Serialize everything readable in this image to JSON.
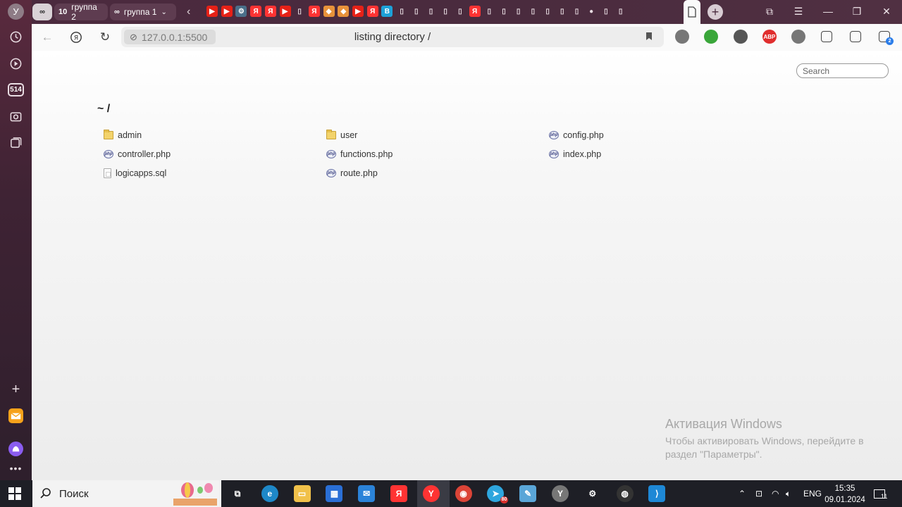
{
  "sidebar": {
    "avatar_letter": "У",
    "counter_badge": "514"
  },
  "tabs": {
    "groups": [
      {
        "label": "",
        "count": ""
      },
      {
        "label": "группа 2",
        "count": "10"
      },
      {
        "label": "группа 1",
        "count": "oo"
      }
    ],
    "pinned_icons": [
      {
        "icon": "youtube-icon",
        "color": "#e62117",
        "glyph": "▶"
      },
      {
        "icon": "youtube-icon",
        "color": "#e62117",
        "glyph": "▶"
      },
      {
        "icon": "settings-icon",
        "color": "#4a6f8a",
        "glyph": "⚙"
      },
      {
        "icon": "yandex-icon",
        "color": "#f33",
        "glyph": "Я"
      },
      {
        "icon": "yandex-icon",
        "color": "#f33",
        "glyph": "Я"
      },
      {
        "icon": "youtube-icon",
        "color": "#e62117",
        "glyph": "▶"
      },
      {
        "icon": "document-icon",
        "color": "transparent",
        "glyph": "▯"
      },
      {
        "icon": "yandex-icon",
        "color": "#f33",
        "glyph": "Я"
      },
      {
        "icon": "diamond-icon",
        "color": "#e8923a",
        "glyph": "◆"
      },
      {
        "icon": "diamond-icon",
        "color": "#e8923a",
        "glyph": "◆"
      },
      {
        "icon": "youtube-icon",
        "color": "#e62117",
        "glyph": "▶"
      },
      {
        "icon": "yandex-icon",
        "color": "#f33",
        "glyph": "Я"
      },
      {
        "icon": "bookmark-blue-icon",
        "color": "#1da1d8",
        "glyph": "B"
      },
      {
        "icon": "document-icon",
        "color": "transparent",
        "glyph": "▯"
      },
      {
        "icon": "document-icon",
        "color": "transparent",
        "glyph": "▯"
      },
      {
        "icon": "document-icon",
        "color": "transparent",
        "glyph": "▯"
      },
      {
        "icon": "document-icon",
        "color": "transparent",
        "glyph": "▯"
      },
      {
        "icon": "document-icon",
        "color": "transparent",
        "glyph": "▯"
      },
      {
        "icon": "yandex-icon",
        "color": "#f33",
        "glyph": "Я"
      },
      {
        "icon": "document-icon",
        "color": "transparent",
        "glyph": "▯"
      },
      {
        "icon": "document-icon",
        "color": "transparent",
        "glyph": "▯"
      },
      {
        "icon": "document-icon",
        "color": "transparent",
        "glyph": "▯"
      },
      {
        "icon": "document-icon",
        "color": "transparent",
        "glyph": "▯"
      },
      {
        "icon": "document-icon",
        "color": "transparent",
        "glyph": "▯"
      },
      {
        "icon": "document-icon",
        "color": "transparent",
        "glyph": "▯"
      },
      {
        "icon": "document-icon",
        "color": "transparent",
        "glyph": "▯"
      },
      {
        "icon": "github-icon",
        "color": "transparent",
        "glyph": "●"
      },
      {
        "icon": "document-icon",
        "color": "transparent",
        "glyph": "▯"
      },
      {
        "icon": "document-icon",
        "color": "transparent",
        "glyph": "▯"
      }
    ]
  },
  "address_bar": {
    "url": "127.0.0.1:5500",
    "page_title": "listing directory /"
  },
  "extensions": [
    {
      "icon": "circle-ext-icon",
      "color": "#777",
      "label": ""
    },
    {
      "icon": "download-arrow-ext-icon",
      "color": "#3aa63a",
      "label": ""
    },
    {
      "icon": "planet-ext-icon",
      "color": "#555",
      "label": ""
    },
    {
      "icon": "adblock-ext-icon",
      "color": "#e02d2d",
      "label": "ABP"
    },
    {
      "icon": "shield-ext-icon",
      "color": "#777",
      "label": ""
    },
    {
      "icon": "puzzle-ext-icon",
      "color": "transparent",
      "label": ""
    },
    {
      "icon": "screen-ext-icon",
      "color": "transparent",
      "label": ""
    },
    {
      "icon": "downloads-icon",
      "color": "transparent",
      "label": "2"
    }
  ],
  "listing": {
    "search_placeholder": "Search",
    "heading": "~ /",
    "entries": [
      {
        "name": "admin",
        "type": "folder"
      },
      {
        "name": "user",
        "type": "folder"
      },
      {
        "name": "config.php",
        "type": "php"
      },
      {
        "name": "controller.php",
        "type": "php"
      },
      {
        "name": "functions.php",
        "type": "php"
      },
      {
        "name": "index.php",
        "type": "php"
      },
      {
        "name": "logicapps.sql",
        "type": "sql"
      },
      {
        "name": "route.php",
        "type": "php"
      }
    ]
  },
  "watermark": {
    "title": "Активация Windows",
    "text": "Чтобы активировать Windows, перейдите в раздел \"Параметры\"."
  },
  "taskbar": {
    "search_label": "Поиск",
    "apps": [
      {
        "name": "task-view-icon",
        "color": "transparent",
        "glyph": "⧉"
      },
      {
        "name": "edge-icon",
        "color": "#1e88c8",
        "glyph": "e"
      },
      {
        "name": "explorer-icon",
        "color": "#f1c14a",
        "glyph": "▭"
      },
      {
        "name": "store-icon",
        "color": "#2a6fd6",
        "glyph": "▦"
      },
      {
        "name": "mail-icon",
        "color": "#2b83d9",
        "glyph": "✉"
      },
      {
        "name": "yandex-icon",
        "color": "#f33",
        "glyph": "Я"
      },
      {
        "name": "yandex-browser-icon",
        "color": "#f33",
        "glyph": "Y"
      },
      {
        "name": "chrome-icon",
        "color": "#db4437",
        "glyph": "◉"
      },
      {
        "name": "telegram-icon",
        "color": "#2ea6de",
        "glyph": "➤"
      },
      {
        "name": "notepad-icon",
        "color": "#5aa6d8",
        "glyph": "✎"
      },
      {
        "name": "yandex-app-icon",
        "color": "#777",
        "glyph": "Y"
      },
      {
        "name": "settings-icon",
        "color": "transparent",
        "glyph": "⚙"
      },
      {
        "name": "obs-icon",
        "color": "#333",
        "glyph": "◍"
      },
      {
        "name": "vscode-icon",
        "color": "#1e88d6",
        "glyph": "⟩"
      }
    ],
    "telegram_badge": "80",
    "language": "ENG",
    "time": "15:35",
    "date": "09.01.2024",
    "notifications_count": "11"
  }
}
